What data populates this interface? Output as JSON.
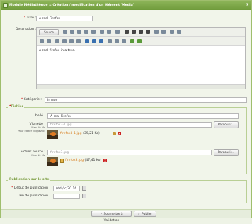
{
  "window": {
    "title": "Module Médiathèque :: Création / modification d'un élément 'Media'",
    "help": "?"
  },
  "form": {
    "titre": {
      "label": "Titre :",
      "value": "A real Firefox"
    },
    "description": {
      "label": "Description :",
      "source_label": "Source",
      "content": "A real firefox in a tree."
    },
    "categorie": {
      "label": "Catégorie :",
      "value": "Image"
    }
  },
  "fichier": {
    "legend": "Fichier",
    "libelle": {
      "label": "Libellé :",
      "value": "A real Firefox"
    },
    "vignette": {
      "label": "Vignette :",
      "sub1": "Max 10 Mo",
      "sub2": "Pour éditer cliquez ici",
      "input_value": "firefox3-1.jpg",
      "file_name": "firefox3-1.jpg",
      "file_size": "(39,21 Ko)",
      "browse_label": "Parcourir..."
    },
    "source": {
      "label": "Fichier source :",
      "sub1": "Max 10 Mo",
      "input_value": "firefox3.jpg",
      "file_name": "firefox3.jpg",
      "file_size": "(47,41 Ko)",
      "browse_label": "Parcourir..."
    }
  },
  "publication": {
    "legend": "Publication sur le site",
    "debut": {
      "label": "Début de publication :",
      "value": "(dd / c/20 16"
    },
    "fin": {
      "label": "Fin de publication :",
      "value": ""
    }
  },
  "actions": {
    "submit_label": "Soumettre à Validation",
    "publish_label": "Publier"
  }
}
